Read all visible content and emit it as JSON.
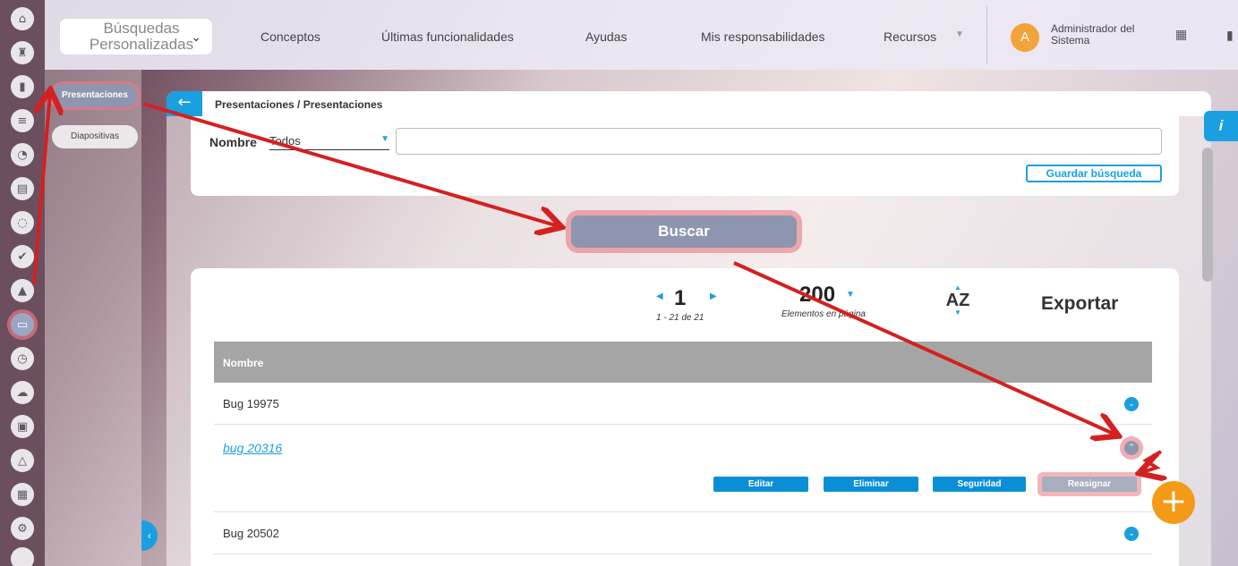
{
  "topbar": {
    "search_select": "Búsquedas Personalizadas",
    "nav": [
      "Conceptos",
      "Últimas funcionalidades",
      "Ayudas",
      "Mis responsabilidades",
      "Recursos"
    ],
    "user_initial": "A",
    "user_name": "Administrador del Sistema"
  },
  "sidemenu": {
    "items": [
      "Presentaciones",
      "Diapositivas"
    ]
  },
  "panel": {
    "title": "Presentaciones / Presentaciones"
  },
  "filter": {
    "label": "Nombre",
    "select_value": "Todos",
    "save_search_label": "Guardar búsqueda"
  },
  "search_button": "Buscar",
  "pager": {
    "page": "1",
    "range": "1 - 21 de 21",
    "per_page": "200",
    "per_page_label": "Elementos en página",
    "sort_label": "AZ",
    "export_label": "Exportar"
  },
  "table": {
    "header": "Nombre",
    "rows": [
      "Bug 19975",
      "bug 20316",
      "Bug 20502"
    ],
    "actions": [
      "Editar",
      "Eliminar",
      "Seguridad",
      "Reasignar"
    ]
  },
  "icons": {
    "info": "i",
    "add": "+"
  },
  "colors": {
    "accent": "#1a9fe0",
    "highlight": "#e87882",
    "fab": "#f39a17",
    "annotation_arrow": "#d42020"
  }
}
